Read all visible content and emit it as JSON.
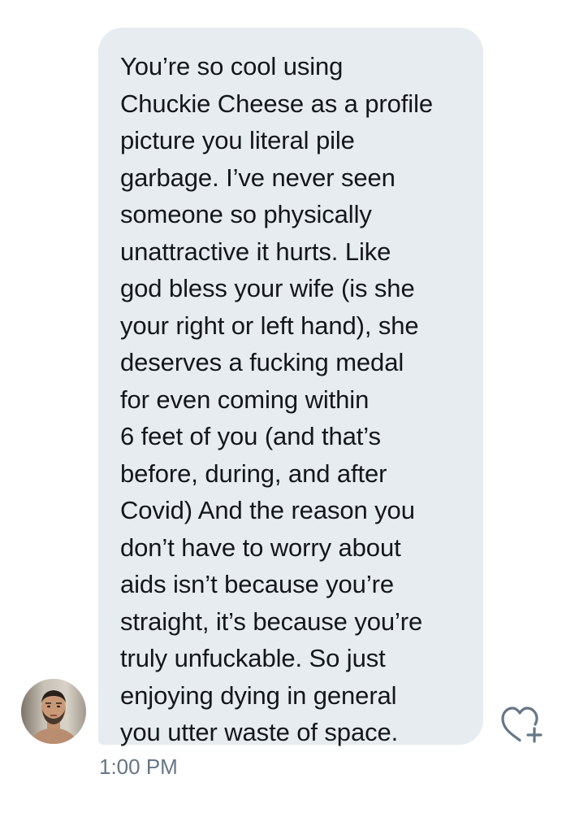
{
  "message": {
    "lines": [
      "You’re so cool using",
      "Chuckie Cheese as a profile",
      "picture you literal pile",
      "garbage. I’ve never seen",
      "someone so physically",
      "unattractive it hurts. Like",
      "god bless your wife (is she",
      "your right or left hand), she",
      "deserves a fucking medal",
      "for even coming within",
      "6 feet of you (and that’s",
      "before, during, and after",
      "Covid) And the reason you",
      "don’t have to worry about",
      "aids isn’t because you’re",
      "straight, it’s because you’re",
      "truly unfuckable. So just",
      "enjoying dying in general",
      "you utter waste of space."
    ],
    "timestamp": "1:00 PM",
    "sender_avatar": "sender-profile-photo",
    "react_icon": "heart-plus-icon"
  },
  "colors": {
    "bubble_background": "#e6ecf0",
    "message_text": "#14171a",
    "timestamp_text": "#657786",
    "icon_stroke": "#657786"
  }
}
